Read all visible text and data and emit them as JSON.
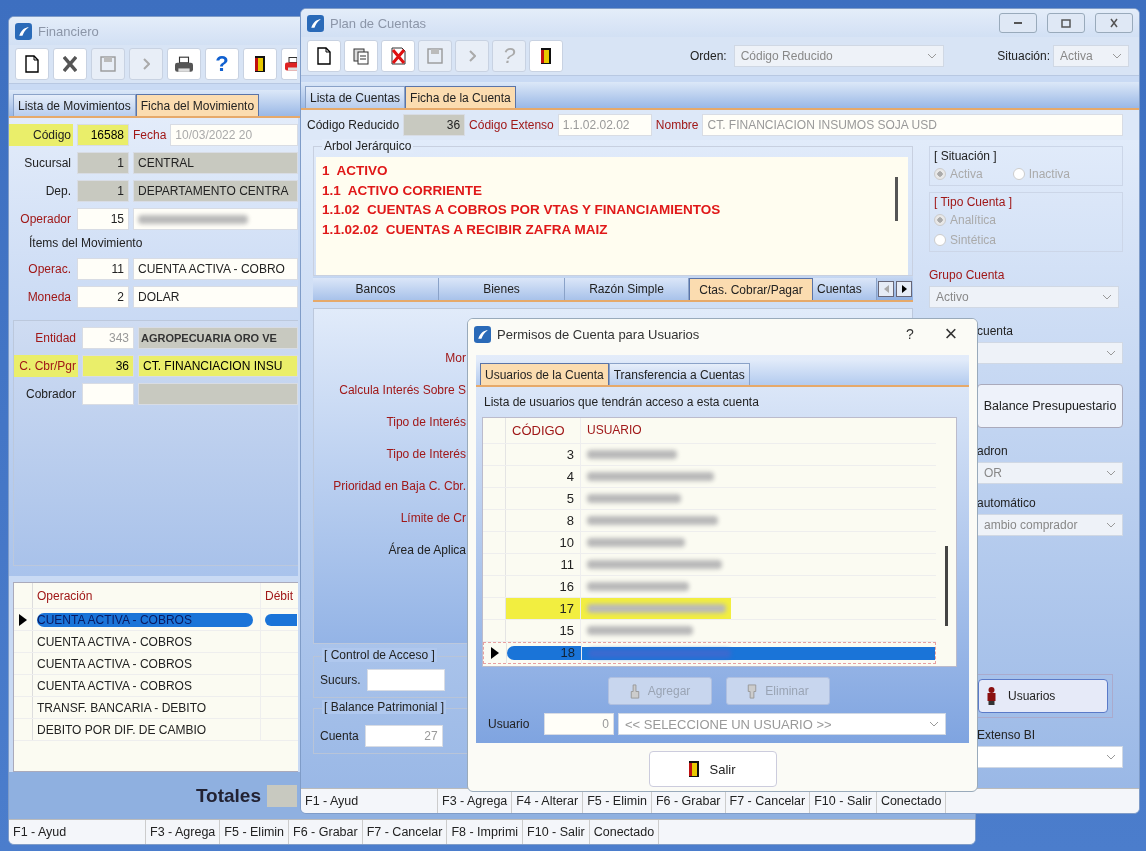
{
  "financiero": {
    "title": "Financiero",
    "toolbar": [
      {
        "kind": "new",
        "disabled": false
      },
      {
        "kind": "delete",
        "disabled": false
      },
      {
        "kind": "save",
        "disabled": true
      },
      {
        "kind": "arrow",
        "disabled": true
      },
      {
        "kind": "print",
        "disabled": false
      },
      {
        "kind": "help",
        "glyph": "?",
        "disabled": false
      },
      {
        "kind": "exit",
        "disabled": false
      },
      {
        "kind": "print-red",
        "disabled": false
      }
    ],
    "tabs": [
      {
        "label": "Lista de Movimientos",
        "selected": false
      },
      {
        "label": "Ficha del Movimiento",
        "selected": true
      }
    ],
    "codigo": {
      "label": "Código",
      "value": "16588",
      "highlighted": true
    },
    "fecha": {
      "label": "Fecha",
      "value": "10/03/2022 20"
    },
    "header_fields": [
      {
        "label": "Sucursal",
        "code": "1",
        "name": "CENTRAL",
        "required": false,
        "code_readonly": true,
        "readonly": true,
        "highlighted": false
      },
      {
        "label": "Dep.",
        "code": "1",
        "name": "DEPARTAMENTO CENTRA",
        "required": false,
        "code_readonly": true,
        "readonly": true,
        "highlighted": false
      },
      {
        "label": "Operador",
        "code": "15",
        "blurred": true,
        "required": true,
        "code_readonly": false,
        "readonly": false,
        "highlighted": false
      }
    ],
    "items_caption": "Ítems del Movimiento",
    "item_fields": [
      {
        "label": "Operac.",
        "code": "11",
        "name": "CUENTA ACTIVA - COBRO",
        "required": true,
        "code_readonly": false,
        "readonly": false,
        "highlighted": false
      },
      {
        "label": "Moneda",
        "code": "2",
        "name": "DOLAR",
        "required": true,
        "code_readonly": false,
        "readonly": false,
        "highlighted": false
      }
    ],
    "panel_fields": [
      {
        "label": "Entidad",
        "code": "343",
        "name": "AGROPECUARIA ORO VE",
        "required": true,
        "code_readonly": false,
        "readonly": true,
        "highlighted": false
      },
      {
        "label": "C. Cbr/Pgr",
        "code": "36",
        "name": "CT. FINANCIACION INSU",
        "required": true,
        "code_readonly": false,
        "readonly": false,
        "highlighted": true
      },
      {
        "label": "Cobrador",
        "required": false,
        "code_readonly": false,
        "readonly": true,
        "highlighted": false
      }
    ],
    "grid": {
      "columns": [
        "Operación",
        "Débit"
      ],
      "rows": [
        {
          "operacion": "CUENTA ACTIVA - COBROS",
          "selected": true
        },
        {
          "operacion": "CUENTA ACTIVA - COBROS",
          "selected": false
        },
        {
          "operacion": "CUENTA ACTIVA - COBROS",
          "selected": false
        },
        {
          "operacion": "CUENTA ACTIVA - COBROS",
          "selected": false
        },
        {
          "operacion": "TRANSF. BANCARIA - DEBITO",
          "selected": false
        },
        {
          "operacion": "DEBITO POR DIF. DE CAMBIO",
          "selected": false
        }
      ]
    },
    "totals_label": "Totales",
    "status": [
      "F1 - Ayud",
      "F3 - Agrega",
      "F5 - Elimin",
      "F6 - Grabar",
      "F7 - Cancelar",
      "F8 - Imprimi",
      "F10 - Salir",
      "Conectado"
    ]
  },
  "plan": {
    "title": "Plan de Cuentas",
    "toolbar": [
      {
        "kind": "new",
        "disabled": false
      },
      {
        "kind": "copy",
        "disabled": false
      },
      {
        "kind": "delete-red",
        "disabled": false
      },
      {
        "kind": "save",
        "disabled": true
      },
      {
        "kind": "arrow",
        "disabled": true
      },
      {
        "kind": "help",
        "glyph": "?",
        "disabled": true
      },
      {
        "kind": "exit",
        "disabled": false
      }
    ],
    "orden": {
      "label": "Orden:",
      "value": "Código Reducido"
    },
    "situacion_filter": {
      "label": "Situación:",
      "value": "Activa"
    },
    "tabs": [
      {
        "label": "Lista de Cuentas",
        "selected": false
      },
      {
        "label": "Ficha de la Cuenta",
        "selected": true
      }
    ],
    "codigo_reducido": {
      "label": "Código Reducido",
      "value": "36"
    },
    "codigo_extenso": {
      "label": "Código Extenso",
      "value": "1.1.02.02.02"
    },
    "nombre": {
      "label": "Nombre",
      "value": "CT. FINANCIACION INSUMOS SOJA USD"
    },
    "arbol": {
      "title": "Arbol Jerárquico",
      "lines": [
        "1  ACTIVO",
        "1.1  ACTIVO CORRIENTE",
        "1.1.02  CUENTAS A COBROS POR VTAS Y FINANCIAMIENTOS",
        "1.1.02.02  CUENTAS A RECIBIR ZAFRA MAIZ"
      ]
    },
    "situacion": {
      "title": "[ Situación ]",
      "options": [
        {
          "label": "Activa",
          "selected": true
        },
        {
          "label": "Inactiva",
          "selected": false
        }
      ]
    },
    "tipo_cuenta": {
      "title": "[ Tipo Cuenta ]",
      "options": [
        {
          "label": "Analítica",
          "selected": true
        },
        {
          "label": "Sintética",
          "selected": false
        }
      ]
    },
    "grupo_cuenta": {
      "label": "Grupo Cuenta",
      "value": "Activo"
    },
    "right_upper": [
      {
        "kind": "label",
        "text": "cuenta"
      },
      {
        "kind": "dropdown"
      },
      {
        "kind": "button",
        "text": "Balance Presupuestario"
      },
      {
        "kind": "label",
        "text": "adron"
      },
      {
        "kind": "dropdown",
        "value": "OR"
      },
      {
        "kind": "label",
        "text": "automático"
      },
      {
        "kind": "dropdown",
        "value": "ambio comprador"
      }
    ],
    "right_lower": [
      {
        "kind": "user-button",
        "text": "Usuarios"
      },
      {
        "kind": "label",
        "text": "Extenso BI"
      },
      {
        "kind": "dropdown"
      }
    ],
    "subtabs": [
      {
        "label": "Bancos",
        "selected": false
      },
      {
        "label": "Bienes",
        "selected": false
      },
      {
        "label": "Razón Simple",
        "selected": false
      },
      {
        "label": "Ctas. Cobrar/Pagar",
        "selected": true
      },
      {
        "label": "Cuentas",
        "selected": false
      }
    ],
    "panel_labels": [
      {
        "text": "Mor",
        "required": true
      },
      {
        "text": "Calcula Interés Sobre S",
        "required": true
      },
      {
        "text": "Tipo de Interés",
        "required": true
      },
      {
        "text": "Tipo de Interés",
        "required": true
      },
      {
        "text": "Prioridad en Baja C. Cbr.",
        "required": true
      },
      {
        "text": "Límite de Cr",
        "required": true
      },
      {
        "text": "Área de Aplica",
        "required": false
      }
    ],
    "control_acceso": {
      "title": "[ Control de Acceso ]",
      "label": "Sucurs."
    },
    "balance_patrimonial": {
      "title": "[ Balance Patrimonial ]",
      "label": "Cuenta",
      "value": "27"
    },
    "status": [
      "F1 - Ayud",
      "F3 - Agrega",
      "F4 - Alterar",
      "F5 - Elimin",
      "F6 - Grabar",
      "F7 - Cancelar",
      "F10 - Salir",
      "Conectado"
    ]
  },
  "dialog": {
    "title": "Permisos de Cuenta para Usuarios",
    "help": "?",
    "close": "×",
    "tabs": [
      {
        "label": "Usuarios de la Cuenta",
        "selected": true
      },
      {
        "label": "Transferencia a Cuentas",
        "selected": false
      }
    ],
    "caption": "Lista de usuarios que tendrán acceso a esta cuenta",
    "columns": [
      "CÓDIGO",
      "USUARIO"
    ],
    "rows": [
      {
        "code": "3",
        "highlighted": false,
        "selected": false
      },
      {
        "code": "4",
        "highlighted": false,
        "selected": false
      },
      {
        "code": "5",
        "highlighted": false,
        "selected": false
      },
      {
        "code": "8",
        "highlighted": false,
        "selected": false
      },
      {
        "code": "10",
        "highlighted": false,
        "selected": false
      },
      {
        "code": "11",
        "highlighted": false,
        "selected": false
      },
      {
        "code": "16",
        "highlighted": false,
        "selected": false
      },
      {
        "code": "17",
        "highlighted": true,
        "selected": false
      },
      {
        "code": "15",
        "highlighted": false,
        "selected": false
      },
      {
        "code": "18",
        "highlighted": false,
        "selected": true
      }
    ],
    "buttons": [
      {
        "kind": "add",
        "label": "Agregar",
        "disabled": true
      },
      {
        "kind": "remove",
        "label": "Eliminar",
        "disabled": true
      }
    ],
    "usuario": {
      "label": "Usuario",
      "value": "0",
      "selection": "<< SELECCIONE UN USUARIO >>"
    },
    "salir": "Salir"
  }
}
